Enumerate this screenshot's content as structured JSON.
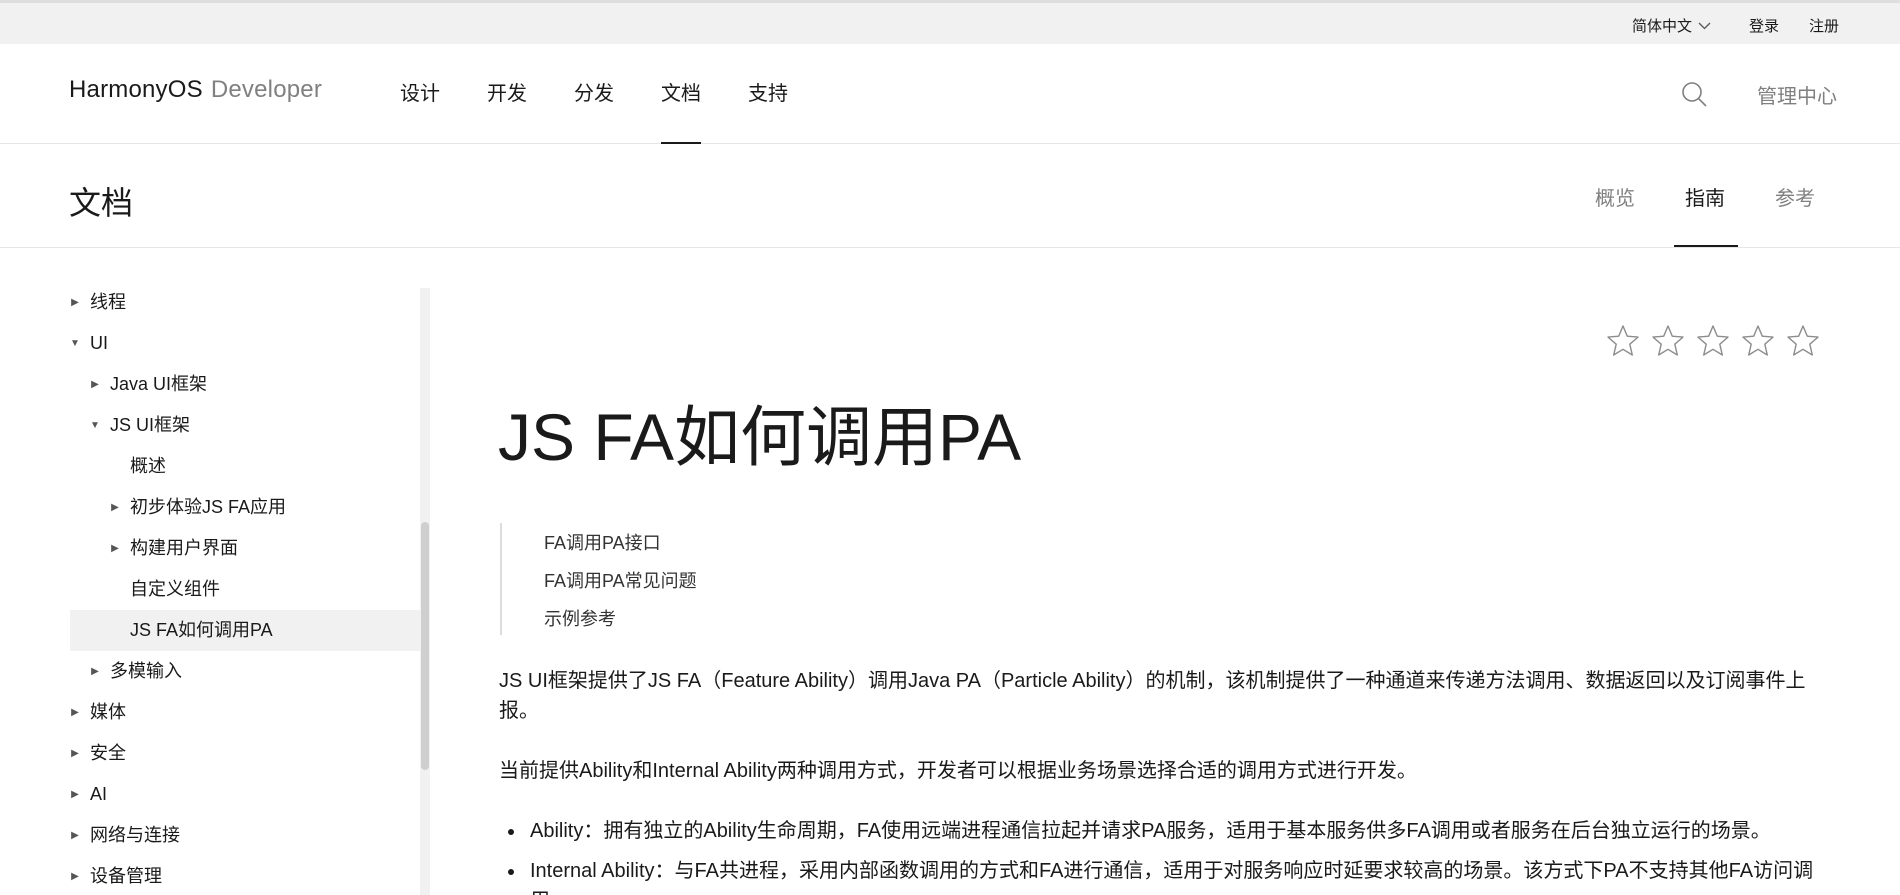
{
  "topbar": {
    "language": "简体中文",
    "login": "登录",
    "register": "注册"
  },
  "header": {
    "brand": "HarmonyOS",
    "brand_sub": "Developer",
    "nav": [
      {
        "label": "设计",
        "active": false
      },
      {
        "label": "开发",
        "active": false
      },
      {
        "label": "分发",
        "active": false
      },
      {
        "label": "文档",
        "active": true
      },
      {
        "label": "支持",
        "active": false
      }
    ],
    "manage_center": "管理中心"
  },
  "subheader": {
    "title": "文档",
    "tabs": [
      {
        "label": "概览",
        "active": false
      },
      {
        "label": "指南",
        "active": true
      },
      {
        "label": "参考",
        "active": false
      }
    ]
  },
  "sidebar": {
    "items": [
      {
        "label": "线程",
        "state": "collapsed"
      },
      {
        "label": "UI",
        "state": "expanded"
      },
      {
        "label": "Java UI框架",
        "state": "collapsed"
      },
      {
        "label": "JS UI框架",
        "state": "expanded"
      },
      {
        "label": "概述",
        "state": "leaf"
      },
      {
        "label": "初步体验JS FA应用",
        "state": "collapsed"
      },
      {
        "label": "构建用户界面",
        "state": "collapsed"
      },
      {
        "label": "自定义组件",
        "state": "leaf"
      },
      {
        "label": "JS FA如何调用PA",
        "state": "leaf",
        "selected": true
      },
      {
        "label": "多模输入",
        "state": "collapsed"
      },
      {
        "label": "媒体",
        "state": "collapsed"
      },
      {
        "label": "安全",
        "state": "collapsed"
      },
      {
        "label": "AI",
        "state": "collapsed"
      },
      {
        "label": "网络与连接",
        "state": "collapsed"
      },
      {
        "label": "设备管理",
        "state": "collapsed"
      }
    ]
  },
  "article": {
    "rating_stars": 5,
    "title": "JS FA如何调用PA",
    "toc": [
      "FA调用PA接口",
      "FA调用PA常见问题",
      "示例参考"
    ],
    "para1": "JS UI框架提供了JS FA（Feature Ability）调用Java PA（Particle Ability）的机制，该机制提供了一种通道来传递方法调用、数据返回以及订阅事件上报。",
    "para2": "当前提供Ability和Internal Ability两种调用方式，开发者可以根据业务场景选择合适的调用方式进行开发。",
    "bullets": [
      "Ability：拥有独立的Ability生命周期，FA使用远端进程通信拉起并请求PA服务，适用于基本服务供多FA调用或者服务在后台独立运行的场景。",
      "Internal Ability：与FA共进程，采用内部函数调用的方式和FA进行通信，适用于对服务响应时延要求较高的场景。该方式下PA不支持其他FA访问调用。"
    ]
  }
}
